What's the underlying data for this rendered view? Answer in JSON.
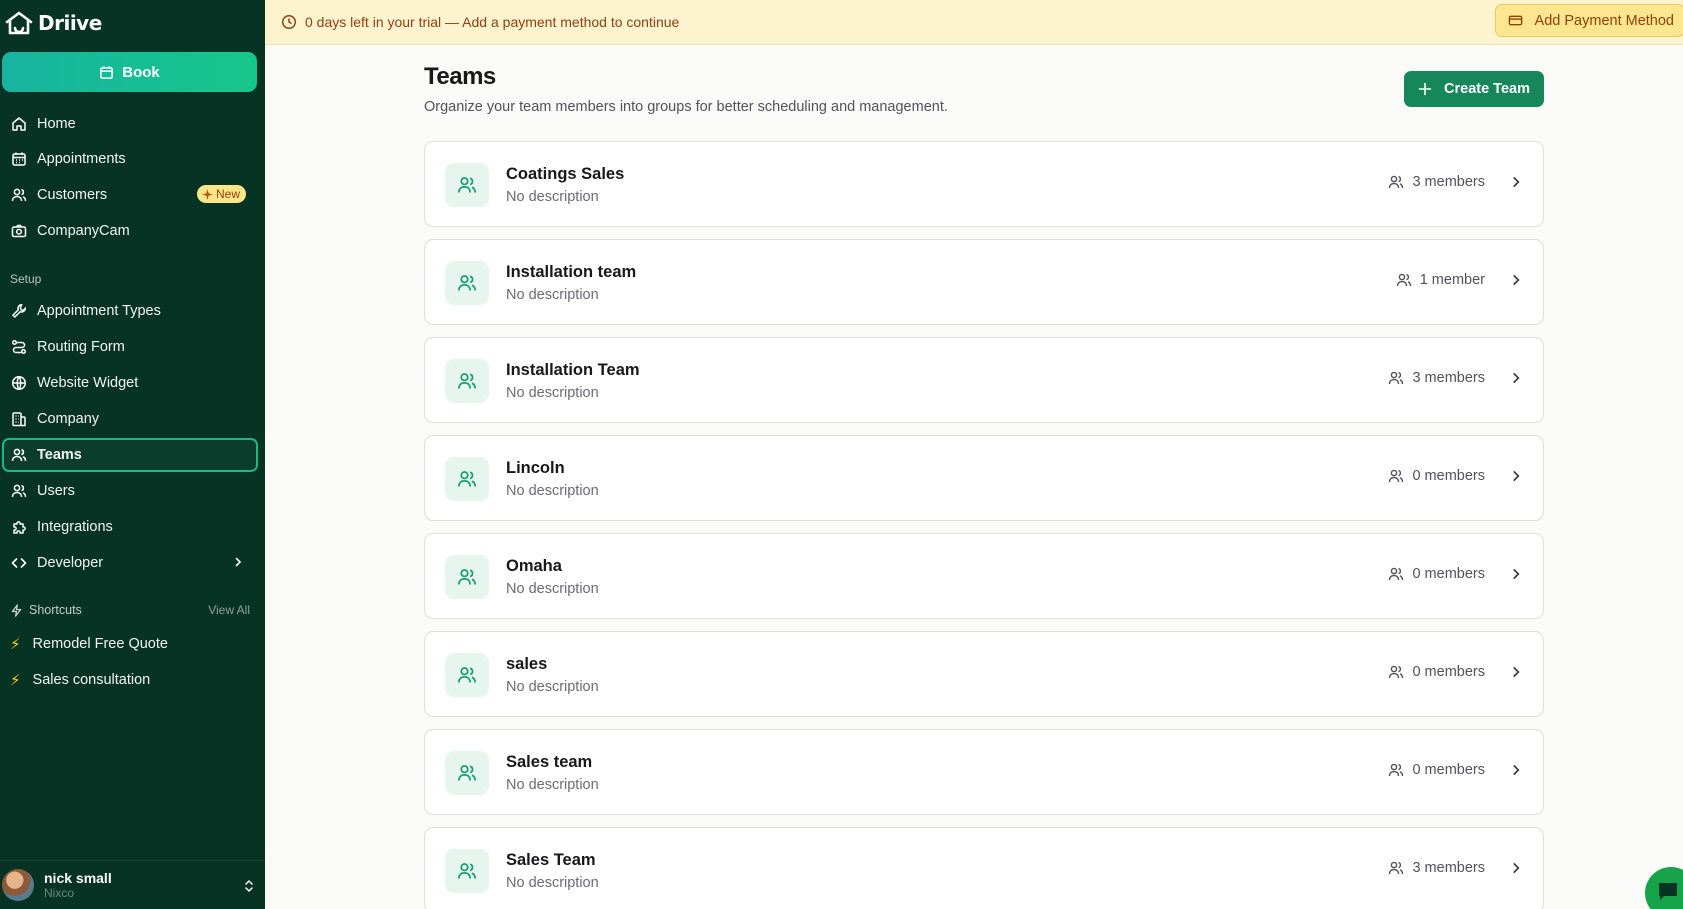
{
  "app": {
    "name": "Driive"
  },
  "sidebar": {
    "book_label": "Book",
    "main_items": [
      {
        "label": "Home",
        "icon": "home-icon"
      },
      {
        "label": "Appointments",
        "icon": "calendar-icon"
      },
      {
        "label": "Customers",
        "icon": "users-icon",
        "badge": "New"
      },
      {
        "label": "CompanyCam",
        "icon": "camera-icon"
      }
    ],
    "setup_label": "Setup",
    "setup_items": [
      {
        "label": "Appointment Types",
        "icon": "wrench-icon"
      },
      {
        "label": "Routing Form",
        "icon": "route-icon"
      },
      {
        "label": "Website Widget",
        "icon": "globe-icon"
      },
      {
        "label": "Company",
        "icon": "building-icon"
      },
      {
        "label": "Teams",
        "icon": "users-icon",
        "active": true
      },
      {
        "label": "Users",
        "icon": "users-icon"
      },
      {
        "label": "Integrations",
        "icon": "puzzle-icon"
      },
      {
        "label": "Developer",
        "icon": "code-icon"
      }
    ],
    "shortcuts_label": "Shortcuts",
    "view_all_label": "View All",
    "shortcuts": [
      {
        "label": "Remodel Free Quote"
      },
      {
        "label": "Sales consultation"
      }
    ],
    "user": {
      "name": "nick small",
      "org": "Nixco"
    }
  },
  "banner": {
    "text": "0 days left in your trial — Add a payment method to continue",
    "button_label": "Add Payment Method"
  },
  "main": {
    "title": "Teams",
    "subtitle": "Organize your team members into groups for better scheduling and management.",
    "create_label": "Create Team",
    "teams": [
      {
        "name": "Coatings Sales",
        "description": "No description",
        "members": "3 members"
      },
      {
        "name": "Installation team",
        "description": "No description",
        "members": "1 member"
      },
      {
        "name": "Installation Team",
        "description": "No description",
        "members": "3 members"
      },
      {
        "name": "Lincoln",
        "description": "No description",
        "members": "0 members"
      },
      {
        "name": "Omaha",
        "description": "No description",
        "members": "0 members"
      },
      {
        "name": "sales",
        "description": "No description",
        "members": "0 members"
      },
      {
        "name": "Sales team",
        "description": "No description",
        "members": "0 members"
      },
      {
        "name": "Sales Team",
        "description": "No description",
        "members": "3 members"
      }
    ]
  },
  "colors": {
    "sidebar_bg": "#063324",
    "accent": "#15875a",
    "banner_bg": "#fdf3cf",
    "banner_text": "#92400e"
  }
}
